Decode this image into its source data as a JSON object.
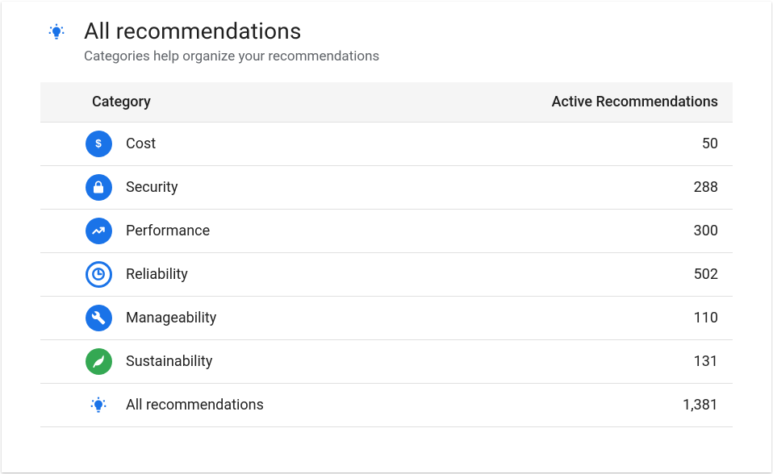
{
  "header": {
    "title": "All recommendations",
    "subtitle": "Categories help organize your recommendations"
  },
  "table": {
    "columns": {
      "category": "Category",
      "active": "Active Recommendations"
    },
    "rows": [
      {
        "icon": "cost",
        "label": "Cost",
        "count": "50"
      },
      {
        "icon": "security",
        "label": "Security",
        "count": "288"
      },
      {
        "icon": "performance",
        "label": "Performance",
        "count": "300"
      },
      {
        "icon": "reliability",
        "label": "Reliability",
        "count": "502"
      },
      {
        "icon": "manageability",
        "label": "Manageability",
        "count": "110"
      },
      {
        "icon": "sustainability",
        "label": "Sustainability",
        "count": "131"
      },
      {
        "icon": "all",
        "label": "All recommendations",
        "count": "1,381"
      }
    ]
  }
}
